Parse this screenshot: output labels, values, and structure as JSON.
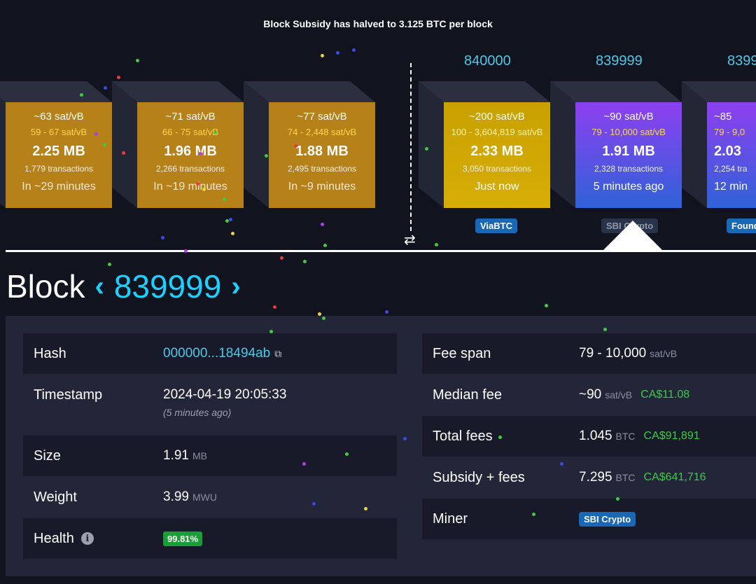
{
  "banner": "Block Subsidy has halved to 3.125 BTC per block",
  "mempool_blocks": [
    {
      "fee": "~63 sat/vB",
      "range": "59 - 67 sat/vB",
      "size": "2.25 MB",
      "tx": "1,779 transactions",
      "time": "In ~29 minutes"
    },
    {
      "fee": "~71 sat/vB",
      "range": "66 - 75 sat/vB",
      "size": "1.96 MB",
      "tx": "2,266 transactions",
      "time": "In ~19 minutes"
    },
    {
      "fee": "~77 sat/vB",
      "range": "74 - 2,448 sat/vB",
      "size": "1.88 MB",
      "tx": "2,495 transactions",
      "time": "In ~9 minutes"
    }
  ],
  "mined_blocks": [
    {
      "height": "840000",
      "fee": "~200 sat/vB",
      "range": "100 - 3,604,819 sat/vB",
      "size": "2.33 MB",
      "tx": "3,050 transactions",
      "time": "Just now",
      "pool": "ViaBTC"
    },
    {
      "height": "839999",
      "fee": "~90 sat/vB",
      "range": "79 - 10,000 sat/vB",
      "size": "1.91 MB",
      "tx": "2,328 transactions",
      "time": "5 minutes ago",
      "pool": "SBI Crypto"
    },
    {
      "height": "8399",
      "fee": "~85",
      "range": "79 - 9,0",
      "size": "2.03",
      "tx": "2,254 tra",
      "time": "12 min",
      "pool": "Found"
    }
  ],
  "swap_icon": "swap-arrows-icon",
  "title": {
    "word": "Block",
    "prev": "‹",
    "number": "839999",
    "next": "›"
  },
  "left_table": {
    "hash": {
      "label": "Hash",
      "value": "000000...18494ab"
    },
    "timestamp": {
      "label": "Timestamp",
      "value": "2024-04-19 20:05:33",
      "sub": "(5 minutes ago)"
    },
    "size": {
      "label": "Size",
      "value": "1.91",
      "unit": "MB"
    },
    "weight": {
      "label": "Weight",
      "value": "3.99",
      "unit": "MWU"
    },
    "health": {
      "label": "Health",
      "value": "99.81%"
    }
  },
  "right_table": {
    "fee_span": {
      "label": "Fee span",
      "value": "79 - 10,000",
      "unit": "sat/vB"
    },
    "median_fee": {
      "label": "Median fee",
      "value": "~90",
      "unit": "sat/vB",
      "fiat": "CA$11.08"
    },
    "total_fees": {
      "label": "Total fees",
      "value": "1.045",
      "unit": "BTC",
      "fiat": "CA$91,891"
    },
    "subsidy_fees": {
      "label": "Subsidy + fees",
      "value": "7.295",
      "unit": "BTC",
      "fiat": "CA$641,716"
    },
    "miner": {
      "label": "Miner",
      "value": "SBI Crypto"
    }
  },
  "colors": {
    "accent": "#1bd1ff",
    "link": "#4fc7e6",
    "fiat": "#3bcc49",
    "badge": "#1967b7",
    "health": "#1a9f36"
  }
}
